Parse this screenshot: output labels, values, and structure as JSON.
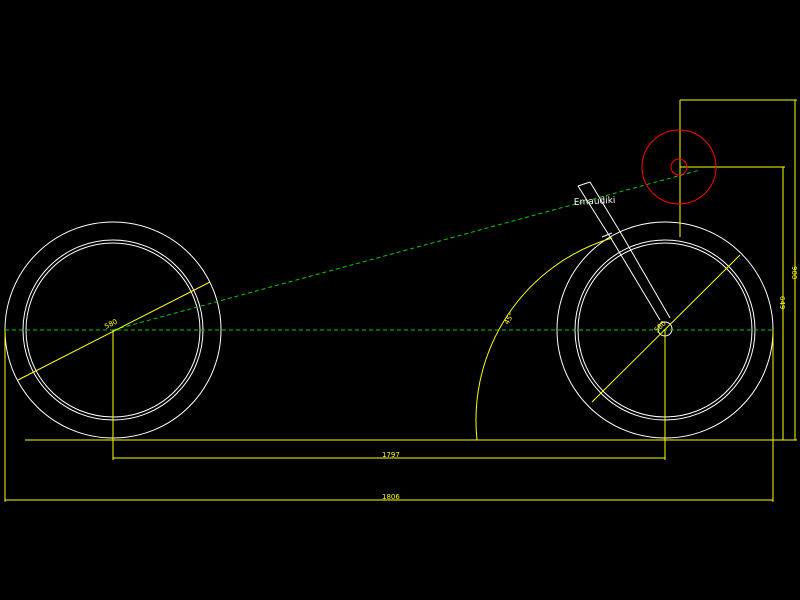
{
  "drawing": {
    "colors": {
      "background": "#000000",
      "geometry": "#ffffff",
      "dimension": "#ffff00",
      "centerline": "#00cc00",
      "steering": "#ff0000"
    },
    "labels": {
      "component_label": "Emaudiki"
    },
    "dimensions": {
      "wheelbase": "1797",
      "overall_length": "1806",
      "rear_wheel_diameter": "580",
      "front_wheel_diameter": "580",
      "angle": "45°",
      "head_height": "649",
      "overall_height": "900"
    }
  }
}
